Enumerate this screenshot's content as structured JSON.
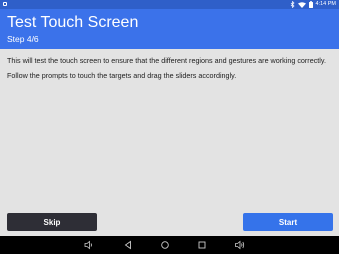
{
  "status_bar": {
    "time": "4:14 PM",
    "icons": [
      "notification-icon",
      "bluetooth-icon",
      "wifi-icon",
      "battery-icon"
    ]
  },
  "header": {
    "title": "Test Touch Screen",
    "step": "Step 4/6"
  },
  "body": {
    "paragraph1": "This will test the touch screen to ensure that the different regions and gestures are working correctly.",
    "paragraph2": "Follow the prompts to touch the targets and drag the sliders accordingly."
  },
  "buttons": {
    "skip_label": "Skip",
    "start_label": "Start"
  },
  "nav_bar": {
    "icons": [
      "volume-down-icon",
      "back-icon",
      "home-icon",
      "recents-icon",
      "volume-up-icon"
    ]
  },
  "colors": {
    "status_bar": "#2f5fc9",
    "header": "#3b72ea",
    "background": "#e3e3e3",
    "skip_button": "#2e2e36",
    "start_button": "#3573ea",
    "nav_bar": "#000000"
  }
}
